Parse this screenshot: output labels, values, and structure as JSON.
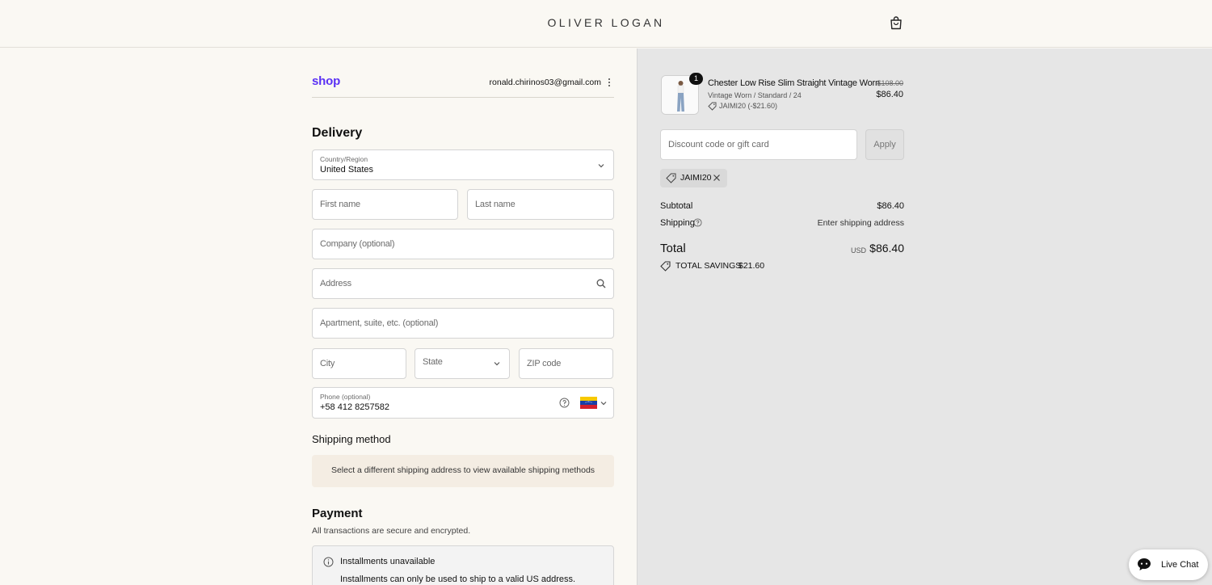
{
  "header": {
    "brand": "OLIVER LOGAN"
  },
  "account": {
    "shop_logo": "shop",
    "email": "ronald.chirinos03@gmail.com"
  },
  "delivery": {
    "title": "Delivery",
    "country_label": "Country/Region",
    "country_value": "United States",
    "first_name_placeholder": "First name",
    "last_name_placeholder": "Last name",
    "company_placeholder": "Company (optional)",
    "address_placeholder": "Address",
    "apartment_placeholder": "Apartment, suite, etc. (optional)",
    "city_placeholder": "City",
    "state_placeholder": "State",
    "zip_placeholder": "ZIP code",
    "phone_label": "Phone (optional)",
    "phone_value": "+58 412 8257582"
  },
  "shipping": {
    "title": "Shipping method",
    "note": "Select a different shipping address to view available shipping methods"
  },
  "payment": {
    "title": "Payment",
    "subtitle": "All transactions are secure and encrypted.",
    "installments_title": "Installments unavailable",
    "installments_note": "Installments can only be used to ship to a valid US address."
  },
  "summary": {
    "quantity": "1",
    "product_title": "Chester Low Rise Slim Straight Vintage Worn",
    "product_variant": "Vintage Worn / Standard / 24",
    "product_discount": "JAIMI20 (-$21.60)",
    "old_price": "$108.00",
    "new_price": "$86.40",
    "discount_placeholder": "Discount code or gift card",
    "apply_label": "Apply",
    "applied_code": "JAIMI20",
    "subtotal_label": "Subtotal",
    "subtotal_value": "$86.40",
    "shipping_label": "Shipping",
    "shipping_value": "Enter shipping address",
    "total_label": "Total",
    "total_currency": "USD",
    "total_value": "$86.40",
    "savings_label": "TOTAL SAVINGS",
    "savings_value": "$21.60"
  },
  "chat": {
    "label": "Live Chat"
  },
  "colors": {
    "shop_purple": "#5a31f4",
    "right_panel_bg": "#e6e6e6",
    "page_bg": "#faf8f3"
  }
}
